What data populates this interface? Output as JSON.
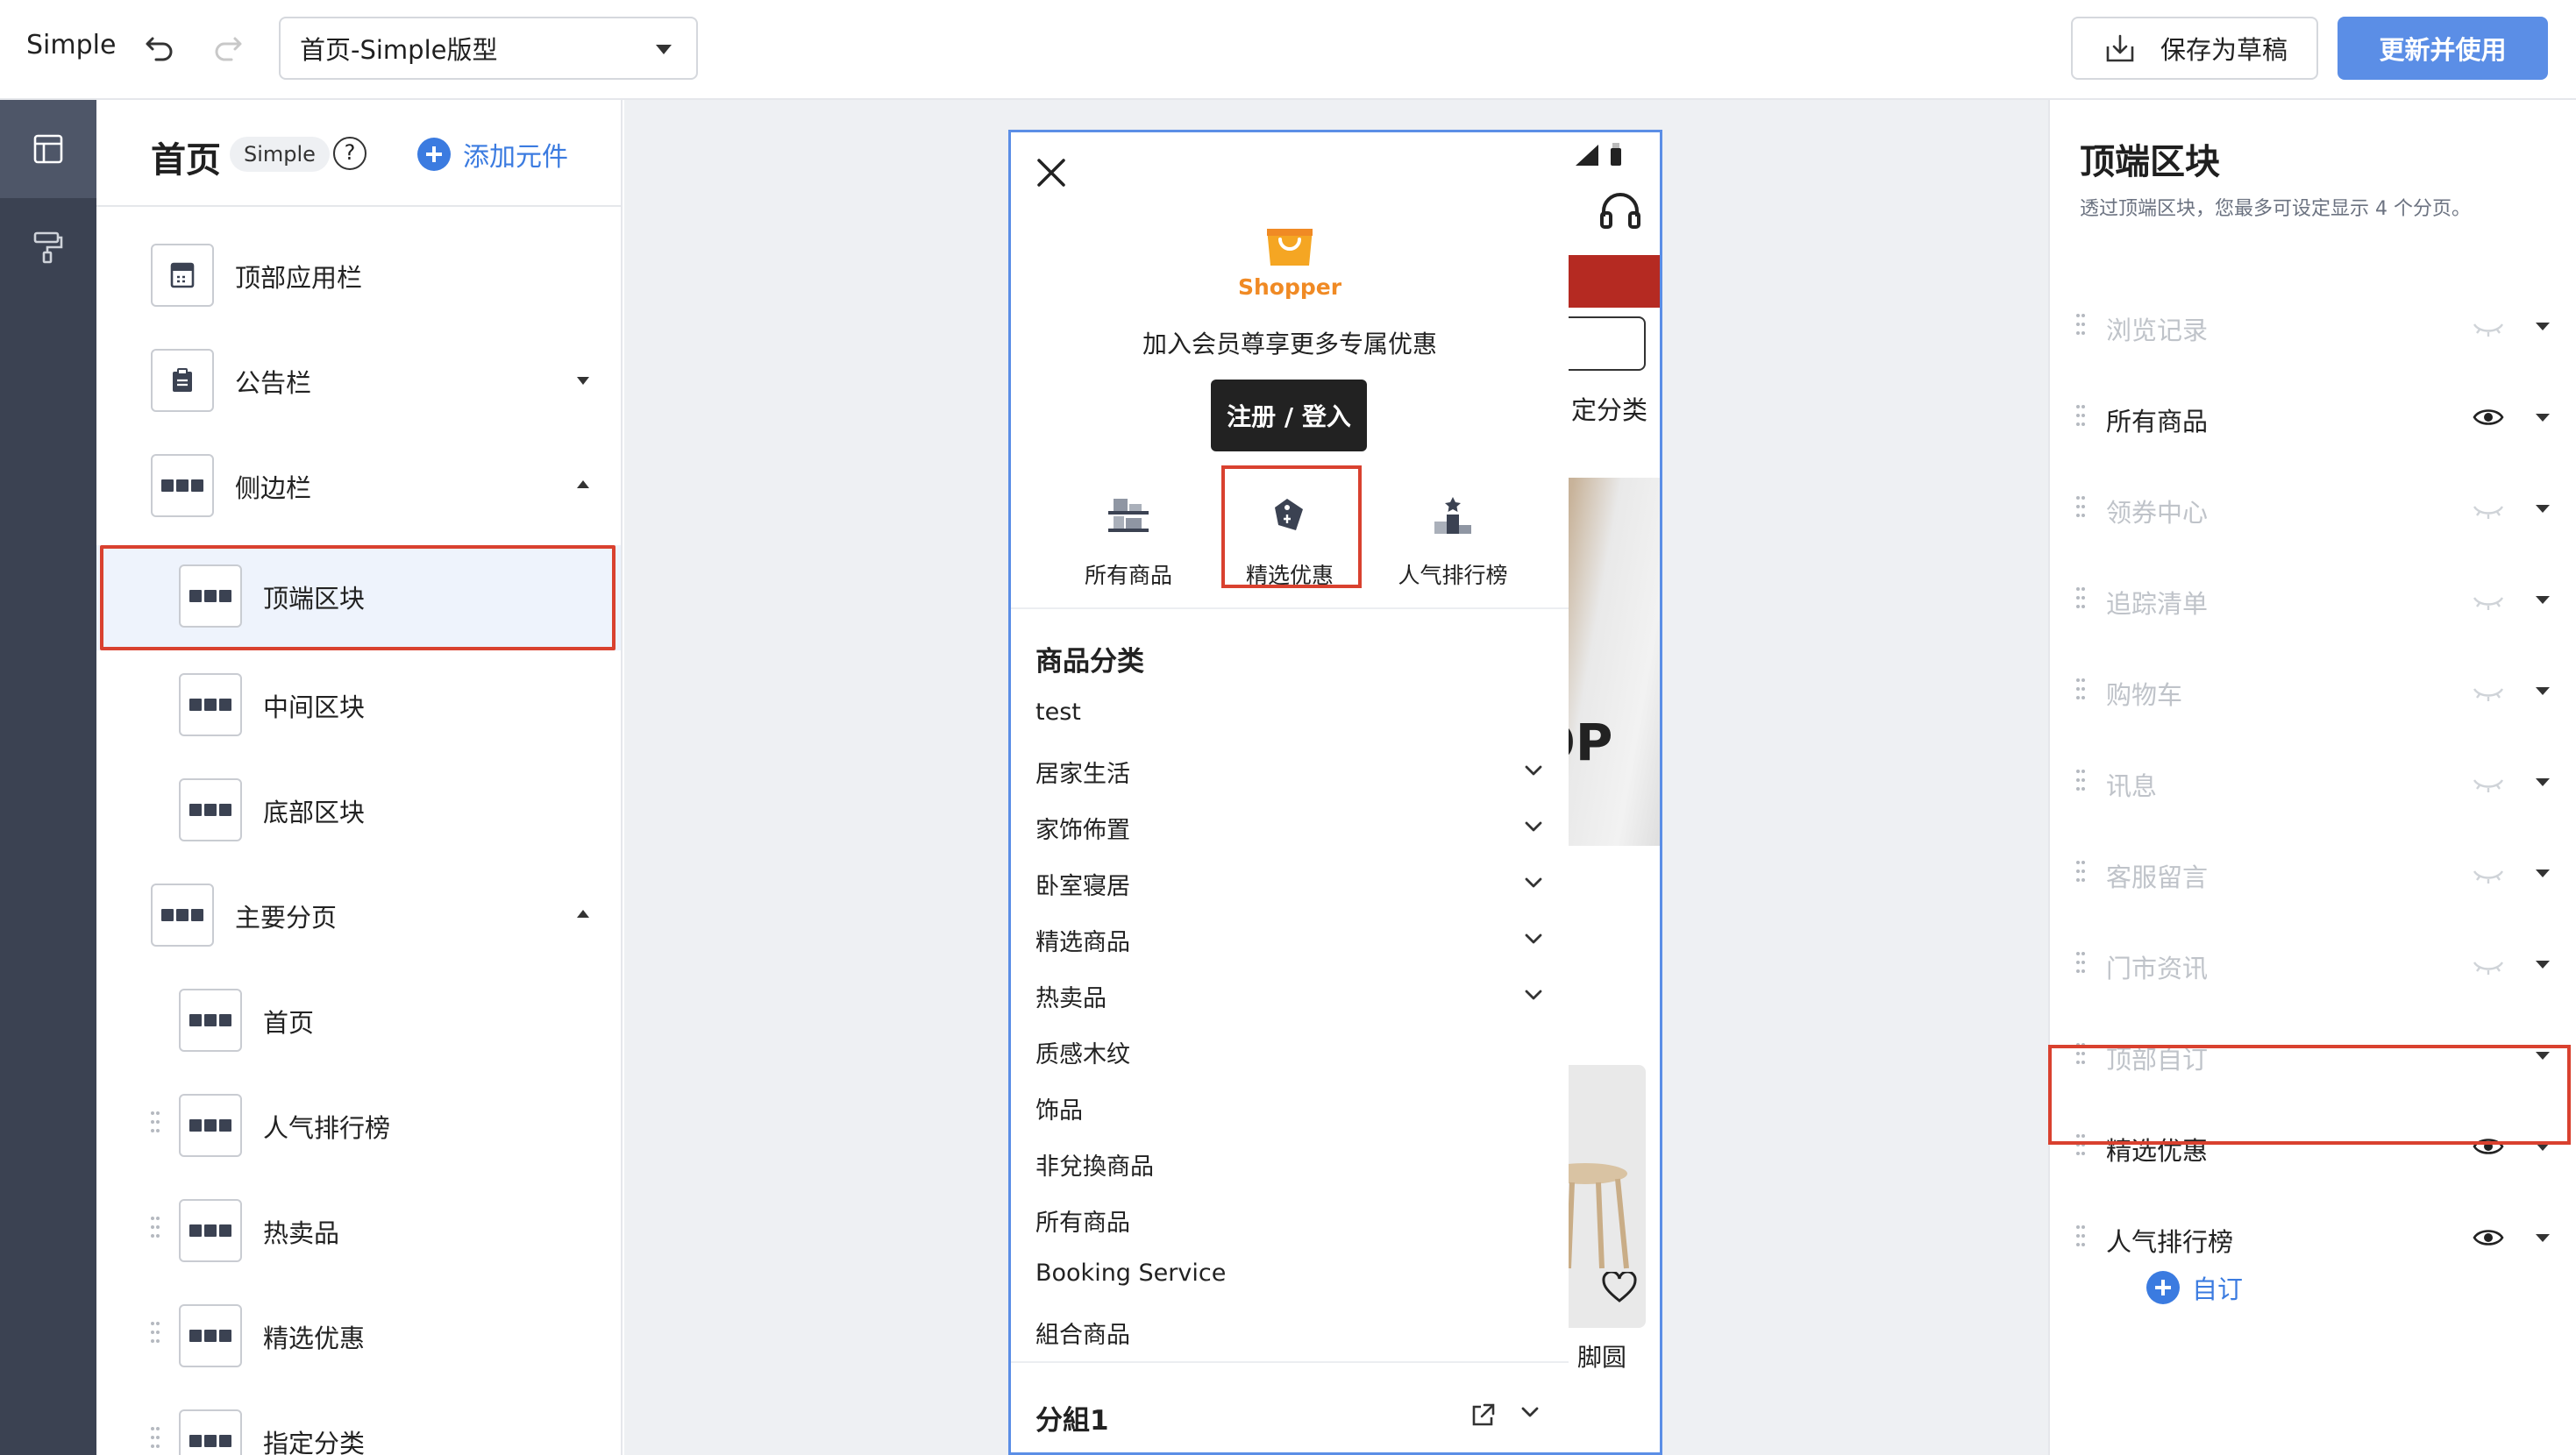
{
  "topbar": {
    "app_title": "Simple",
    "layout_select": "首页-Simple版型",
    "save_draft": "保存为草稿",
    "publish": "更新并使用"
  },
  "left_panel": {
    "title": "首页",
    "badge": "Simple",
    "help": "?",
    "add_label": "添加元件",
    "items": [
      {
        "label": "顶部应用栏"
      },
      {
        "label": "公告栏"
      },
      {
        "label": "侧边栏"
      },
      {
        "label": "顶端区块"
      },
      {
        "label": "中间区块"
      },
      {
        "label": "底部区块"
      },
      {
        "label": "主要分页"
      },
      {
        "label": "首页"
      },
      {
        "label": "人气排行榜"
      },
      {
        "label": "热卖品"
      },
      {
        "label": "精选优惠"
      },
      {
        "label": "指定分类"
      }
    ]
  },
  "preview": {
    "brand": "Shopper",
    "tagline": "加入会员尊享更多专属优惠",
    "login": "注册 / 登入",
    "quick_links": [
      "所有商品",
      "精选优惠",
      "人气排行榜"
    ],
    "category_title": "商品分类",
    "categories": [
      "test",
      "居家生活",
      "家饰佈置",
      "卧室寝居",
      "精选商品",
      "热卖品",
      "质感木纹",
      "饰品",
      "非兌換商品",
      "所有商品",
      "Booking Service",
      "組合商品"
    ],
    "group_title": "分組1",
    "under_text": "定分类",
    "under_img_text": "HOP",
    "under_footer": "脚圆"
  },
  "right_panel": {
    "title": "顶端区块",
    "description": "透过顶端区块，您最多可设定显示 4 个分页。",
    "rows": [
      {
        "label": "浏览记录",
        "visible": false
      },
      {
        "label": "所有商品",
        "visible": true
      },
      {
        "label": "领券中心",
        "visible": false
      },
      {
        "label": "追踪清单",
        "visible": false
      },
      {
        "label": "购物车",
        "visible": false
      },
      {
        "label": "讯息",
        "visible": false
      },
      {
        "label": "客服留言",
        "visible": false
      },
      {
        "label": "门市资讯",
        "visible": false
      },
      {
        "label": "顶部自订",
        "visible": false
      },
      {
        "label": "精选优惠",
        "visible": true
      },
      {
        "label": "人气排行榜",
        "visible": true
      }
    ],
    "add_label": "自订"
  },
  "colors": {
    "accent": "#5b8ee6",
    "link": "#3b7be0",
    "highlight": "#d9412f",
    "brand_orange": "#f08a24",
    "rail": "#3b4252"
  }
}
